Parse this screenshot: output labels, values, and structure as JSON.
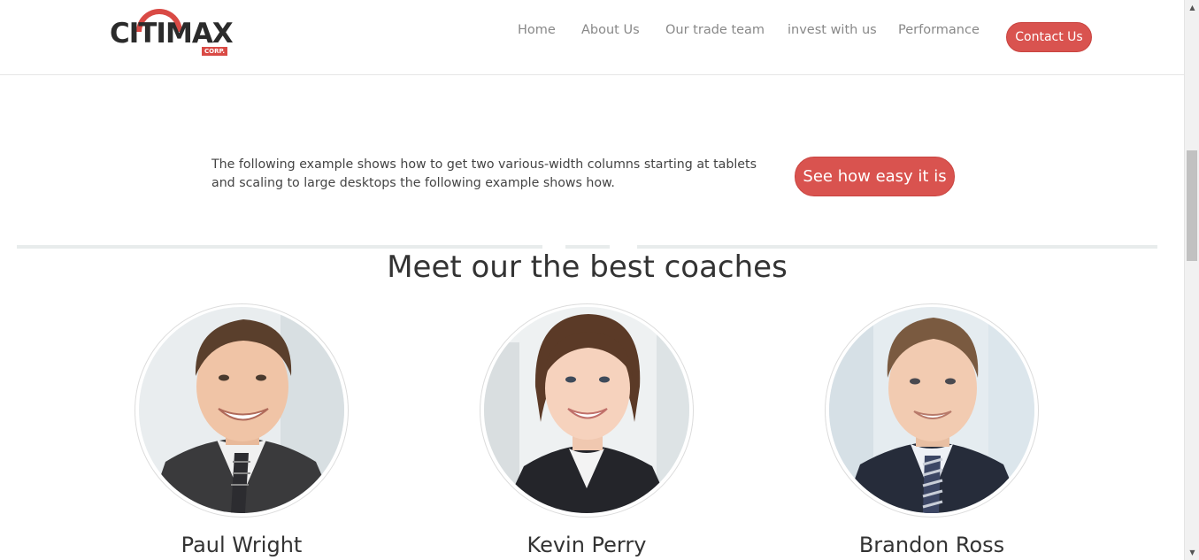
{
  "brand": {
    "logo_text": "CITIMAX",
    "logo_sub": "CORP.",
    "accent_color": "#d9534f"
  },
  "nav": {
    "items": [
      {
        "label": "Home"
      },
      {
        "label": "About Us"
      },
      {
        "label": "Our trade team"
      },
      {
        "label": "invest with us"
      },
      {
        "label": "Performance"
      }
    ],
    "contact_label": "Contact Us"
  },
  "intro": {
    "text": "The following example shows how to get two various-width columns starting at tablets and scaling to large desktops the following example shows how.",
    "cta_label": "See how easy it is"
  },
  "coaches_section": {
    "title": "Meet our the best coaches",
    "coaches": [
      {
        "name": "Paul Wright",
        "photo": "man-smiling-photo"
      },
      {
        "name": "Kevin Perry",
        "photo": "woman-smiling-photo"
      },
      {
        "name": "Brandon Ross",
        "photo": "young-man-photo"
      }
    ]
  }
}
